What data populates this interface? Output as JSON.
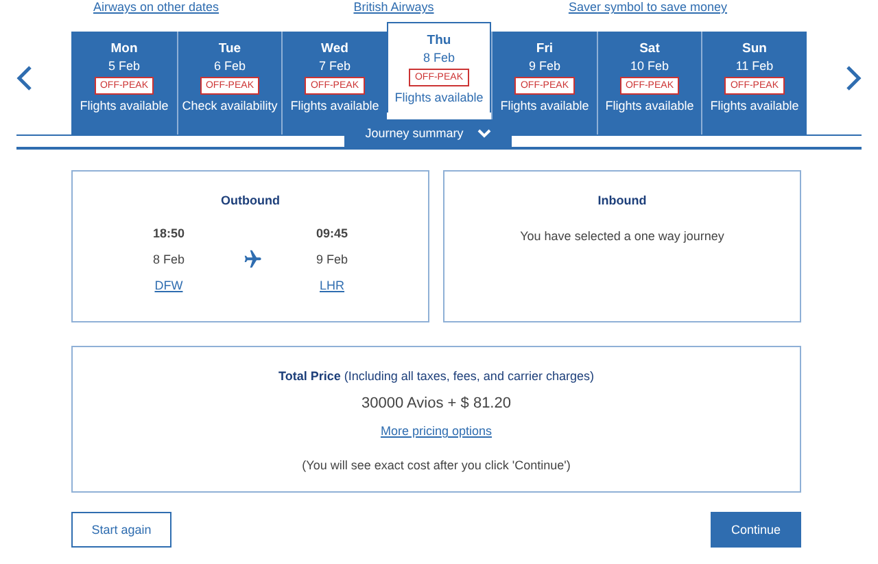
{
  "top_links": [
    "Airways on other dates",
    "British Airways",
    "Saver symbol to save money"
  ],
  "days": [
    {
      "day": "Mon",
      "date": "5 Feb",
      "badge": "OFF-PEAK",
      "status": "Flights available",
      "selected": false
    },
    {
      "day": "Tue",
      "date": "6 Feb",
      "badge": "OFF-PEAK",
      "status": "Check availability",
      "selected": false
    },
    {
      "day": "Wed",
      "date": "7 Feb",
      "badge": "OFF-PEAK",
      "status": "Flights available",
      "selected": false
    },
    {
      "day": "Thu",
      "date": "8 Feb",
      "badge": "OFF-PEAK",
      "status": "Flights available",
      "selected": true
    },
    {
      "day": "Fri",
      "date": "9 Feb",
      "badge": "OFF-PEAK",
      "status": "Flights available",
      "selected": false
    },
    {
      "day": "Sat",
      "date": "10 Feb",
      "badge": "OFF-PEAK",
      "status": "Flights available",
      "selected": false
    },
    {
      "day": "Sun",
      "date": "11 Feb",
      "badge": "OFF-PEAK",
      "status": "Flights available",
      "selected": false
    }
  ],
  "journey_summary": {
    "label": "Journey summary",
    "expanded": false
  },
  "outbound": {
    "title": "Outbound",
    "depart": {
      "time": "18:50",
      "date": "8 Feb",
      "airport": "DFW"
    },
    "arrive": {
      "time": "09:45",
      "date": "9 Feb",
      "airport": "LHR"
    }
  },
  "inbound": {
    "title": "Inbound",
    "message": "You have selected a one way journey"
  },
  "price": {
    "label": "**Total Price** (Including all taxes, fees, and carrier charges)",
    "amount": "30000 Avios + $ 81.20",
    "link": "More pricing options",
    "note": "(You will see exact cost after you click 'Continue')"
  },
  "buttons": {
    "back": "Start again",
    "next": "Continue"
  }
}
